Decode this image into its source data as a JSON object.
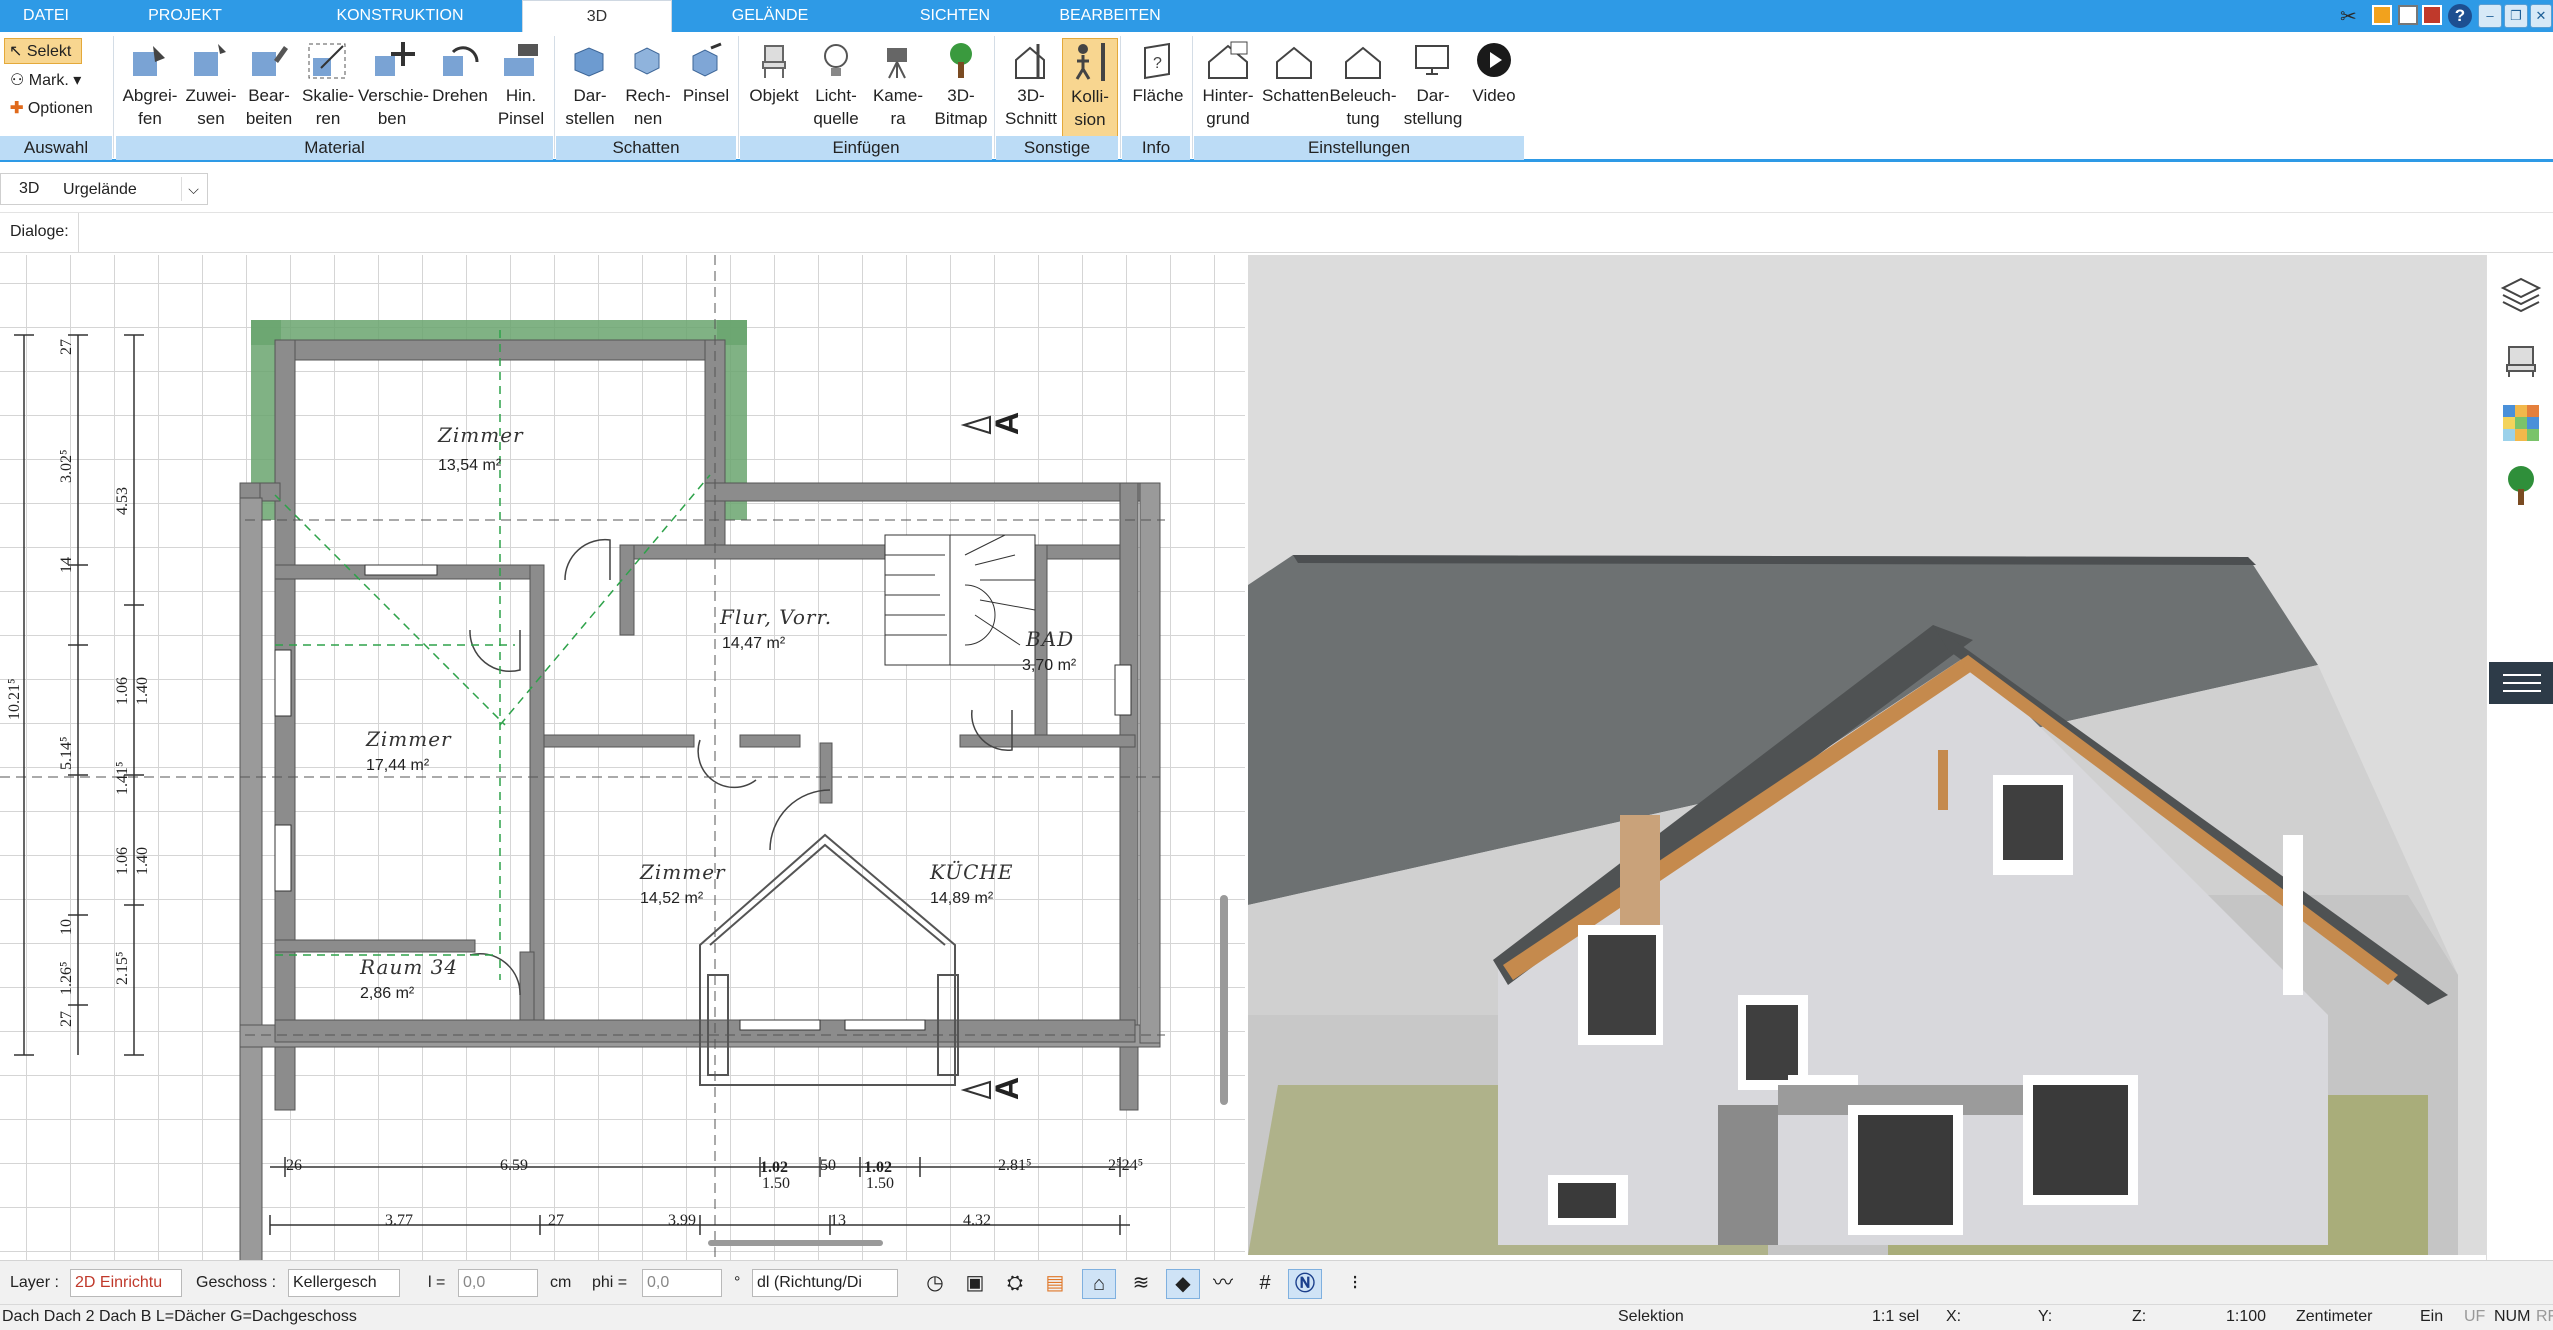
{
  "menu": {
    "tabs": [
      "DATEI",
      "PROJEKT",
      "KONSTRUKTION",
      "3D",
      "GELÄNDE",
      "SICHTEN",
      "BEARBEITEN"
    ],
    "active": "3D"
  },
  "auswahl": {
    "select": "Selekt",
    "mark": "Mark.",
    "options": "Optionen",
    "group": "Auswahl"
  },
  "material": {
    "group": "Material",
    "buttons": [
      "Abgrei-\nfen",
      "Zuwei-\nsen",
      "Bear-\nbeiten",
      "Skalie-\nren",
      "Verschie-\nben",
      "Drehen",
      "Hin.\nPinsel"
    ]
  },
  "schatten": {
    "group": "Schatten",
    "buttons": [
      "Dar-\nstellen",
      "Rech-\nnen",
      "Pinsel"
    ]
  },
  "einfuegen": {
    "group": "Einfügen",
    "buttons": [
      "Objekt",
      "Licht-\nquelle",
      "Kame-\nra",
      "3D-\nBitmap"
    ]
  },
  "sonstige": {
    "group": "Sonstige",
    "buttons": [
      "3D-\nSchnitt",
      "Kolli-\nsion"
    ]
  },
  "info": {
    "group": "Info",
    "buttons": [
      "Fläche"
    ]
  },
  "einstellungen": {
    "group": "Einstellungen",
    "buttons": [
      "Hinter-\ngrund",
      "Schatten",
      "Beleuch-\ntung",
      "Dar-\nstellung",
      "Video"
    ]
  },
  "view_row": {
    "mode": "3D",
    "terrain": "Urgelände"
  },
  "dialoge": "Dialoge:",
  "rooms": [
    {
      "name": "Zimmer",
      "area": "13,54 m²"
    },
    {
      "name": "Flur, Vorr.",
      "area": "14,47 m²"
    },
    {
      "name": "BAD",
      "area": "3,70 m²"
    },
    {
      "name": "Zimmer",
      "area": "17,44 m²"
    },
    {
      "name": "Zimmer",
      "area": "14,52 m²"
    },
    {
      "name": "KÜCHE",
      "area": "14,89 m²"
    },
    {
      "name": "Raum 34",
      "area": "2,86 m²"
    }
  ],
  "section_marker": "A",
  "dims_left_outer": "10.21⁵",
  "dims_left_mid": [
    "27",
    "3.02⁵",
    "14",
    "5.14⁵",
    "10",
    "1.26⁵",
    "27"
  ],
  "dims_left_inner": [
    "4.53",
    "1.06",
    "1.41⁵",
    "1.06",
    "2.15⁵"
  ],
  "dims_left_window": [
    "1.40",
    "1.40"
  ],
  "dims_bottom": [
    "26",
    "6.59",
    "1.02",
    "1.50",
    "50",
    "1.02",
    "1.50",
    "2.81⁵",
    "2⁵24⁵"
  ],
  "dims_bottom2": [
    "3.77",
    "27",
    "3.99",
    "13",
    "4.32"
  ],
  "bottom": {
    "layer_label": "Layer :",
    "layer_value": "2D Einrichtu",
    "geschoss_label": "Geschoss :",
    "geschoss_value": "Kellergesch",
    "l_label": "l =",
    "l_value": "0,0",
    "l_unit": "cm",
    "phi_label": "phi =",
    "phi_value": "0,0",
    "phi_unit": "°",
    "dl_value": "dl (Richtung/Di"
  },
  "status": {
    "hint": "Dach Dach 2 Dach B L=Dächer G=Dachgeschoss",
    "mode": "Selektion",
    "sel": "1:1 sel",
    "x": "X:",
    "y": "Y:",
    "z": "Z:",
    "scale": "1:100",
    "unit": "Zentimeter",
    "ein": "Ein",
    "uf": "UF",
    "num": "NUM",
    "rf": "RF"
  },
  "colors": {
    "accent": "#2e9ae6",
    "group_bar": "#bcdcf6",
    "highlight": "#f8d690",
    "wall": "#8c8c8c",
    "green": "#2ea24a"
  }
}
